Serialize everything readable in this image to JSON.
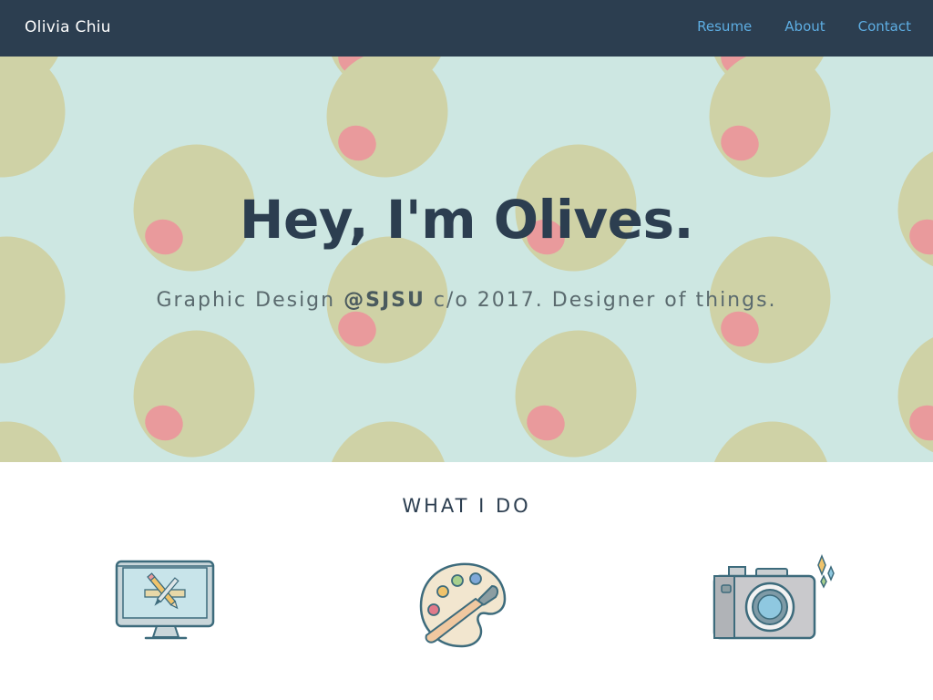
{
  "nav": {
    "brand": "Olivia Chiu",
    "links": [
      {
        "label": "Resume"
      },
      {
        "label": "About"
      },
      {
        "label": "Contact"
      }
    ]
  },
  "hero": {
    "title": "Hey, I'm Olives.",
    "subtitle_pre": "Graphic Design ",
    "subtitle_handle": "@SJSU",
    "subtitle_post": " c/o 2017. Designer of things.",
    "colors": {
      "background": "#cde7e2",
      "olive": "#cfd2a6",
      "pimento": "#e99a9c"
    }
  },
  "services": {
    "title": "WHAT I DO",
    "items": [
      {
        "icon": "monitor-design-icon"
      },
      {
        "icon": "paint-palette-icon"
      },
      {
        "icon": "camera-icon"
      }
    ]
  },
  "colors": {
    "nav_bg": "#2c3e50",
    "nav_link": "#5dade2",
    "heading": "#2c3e50"
  }
}
